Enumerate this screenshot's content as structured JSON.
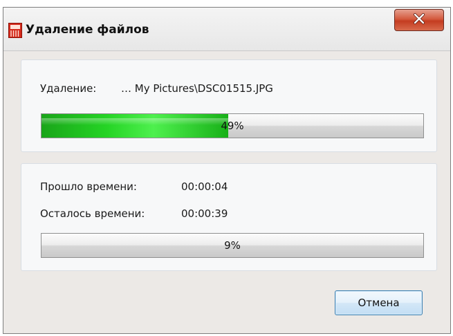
{
  "window": {
    "title": "Удаление файлов",
    "app_icon": "shredder-icon",
    "close_icon": "close-icon",
    "accent_close": "#c43c21"
  },
  "current_file": {
    "label": "Удаление:",
    "path": "… My Pictures\\DSC01515.JPG",
    "progress_percent": 49,
    "progress_text": "49%",
    "bar_color": "#25d425"
  },
  "overall": {
    "elapsed_label": "Прошло времени:",
    "elapsed_value": "00:00:04",
    "remaining_label": "Осталось времени:",
    "remaining_value": "00:00:39",
    "progress_percent": 9,
    "progress_text": "9%"
  },
  "buttons": {
    "cancel_label": "Отмена"
  }
}
